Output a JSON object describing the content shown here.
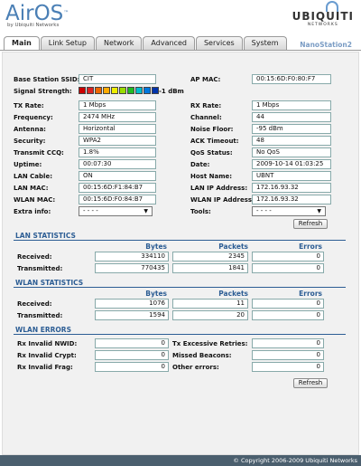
{
  "app": {
    "logo": "AirOS",
    "logo_tm": "™",
    "logo_sub": "by Ubiquiti Networks",
    "vendor": "UBIQUITI",
    "vendor_sub": "NETWORKS",
    "device": "NanoStation2"
  },
  "tabs": [
    "Main",
    "Link Setup",
    "Network",
    "Advanced",
    "Services",
    "System"
  ],
  "status": {
    "ssid_label": "Base Station SSID:",
    "ssid": "CIT",
    "ap_mac_label": "AP MAC:",
    "ap_mac": "00:15:6D:F0:80:F7",
    "signal_label": "Signal Strength:",
    "signal": "-1 dBm",
    "signal_colors": [
      "#cc0000",
      "#dd2222",
      "#ee6600",
      "#ffaa00",
      "#eeee00",
      "#99dd00",
      "#22bb22",
      "#00bbcc",
      "#0077dd",
      "#0033aa"
    ],
    "tx_label": "TX Rate:",
    "tx": "1 Mbps",
    "rx_label": "RX Rate:",
    "rx": "1 Mbps",
    "freq_label": "Frequency:",
    "freq": "2474 MHz",
    "channel_label": "Channel:",
    "channel": "44",
    "antenna_label": "Antenna:",
    "antenna": "Horizontal",
    "noise_label": "Noise Floor:",
    "noise": "-95 dBm",
    "security_label": "Security:",
    "security": "WPA2",
    "ack_label": "ACK Timeout:",
    "ack": "48",
    "ccq_label": "Transmit CCQ:",
    "ccq": "1.8%",
    "qos_label": "QoS Status:",
    "qos": "No QoS",
    "uptime_label": "Uptime:",
    "uptime": "00:07:30",
    "date_label": "Date:",
    "date": "2009-10-14 01:03:25",
    "lancable_label": "LAN Cable:",
    "lancable": "ON",
    "host_label": "Host Name:",
    "host": "UBNT",
    "lanmac_label": "LAN MAC:",
    "lanmac": "00:15:6D:F1:84:B7",
    "lanip_label": "LAN IP Address:",
    "lanip": "172.16.93.32",
    "wlanmac_label": "WLAN MAC:",
    "wlanmac": "00:15:6D:F0:84:B7",
    "wlanip_label": "WLAN IP Address:",
    "wlanip": "172.16.93.32",
    "extra_label": "Extra info:",
    "extra": "- - - -",
    "tools_label": "Tools:",
    "tools": "- - - -",
    "refresh": "Refresh"
  },
  "lan": {
    "title": "LAN STATISTICS",
    "cols": [
      "Bytes",
      "Packets",
      "Errors"
    ],
    "rows": [
      {
        "label": "Received:",
        "bytes": "334110",
        "packets": "2345",
        "errors": "0"
      },
      {
        "label": "Transmitted:",
        "bytes": "770435",
        "packets": "1841",
        "errors": "0"
      }
    ]
  },
  "wlan": {
    "title": "WLAN STATISTICS",
    "cols": [
      "Bytes",
      "Packets",
      "Errors"
    ],
    "rows": [
      {
        "label": "Received:",
        "bytes": "1076",
        "packets": "11",
        "errors": "0"
      },
      {
        "label": "Transmitted:",
        "bytes": "1594",
        "packets": "20",
        "errors": "0"
      }
    ]
  },
  "wlanerr": {
    "title": "WLAN ERRORS",
    "left": [
      {
        "label": "Rx Invalid NWID:",
        "value": "0"
      },
      {
        "label": "Rx Invalid Crypt:",
        "value": "0"
      },
      {
        "label": "Rx Invalid Frag:",
        "value": "0"
      }
    ],
    "right": [
      {
        "label": "Tx Excessive Retries:",
        "value": "0"
      },
      {
        "label": "Missed Beacons:",
        "value": "0"
      },
      {
        "label": "Other errors:",
        "value": "0"
      }
    ],
    "refresh": "Refresh"
  },
  "footer": "© Copyright 2006-2009 Ubiquiti Networks"
}
